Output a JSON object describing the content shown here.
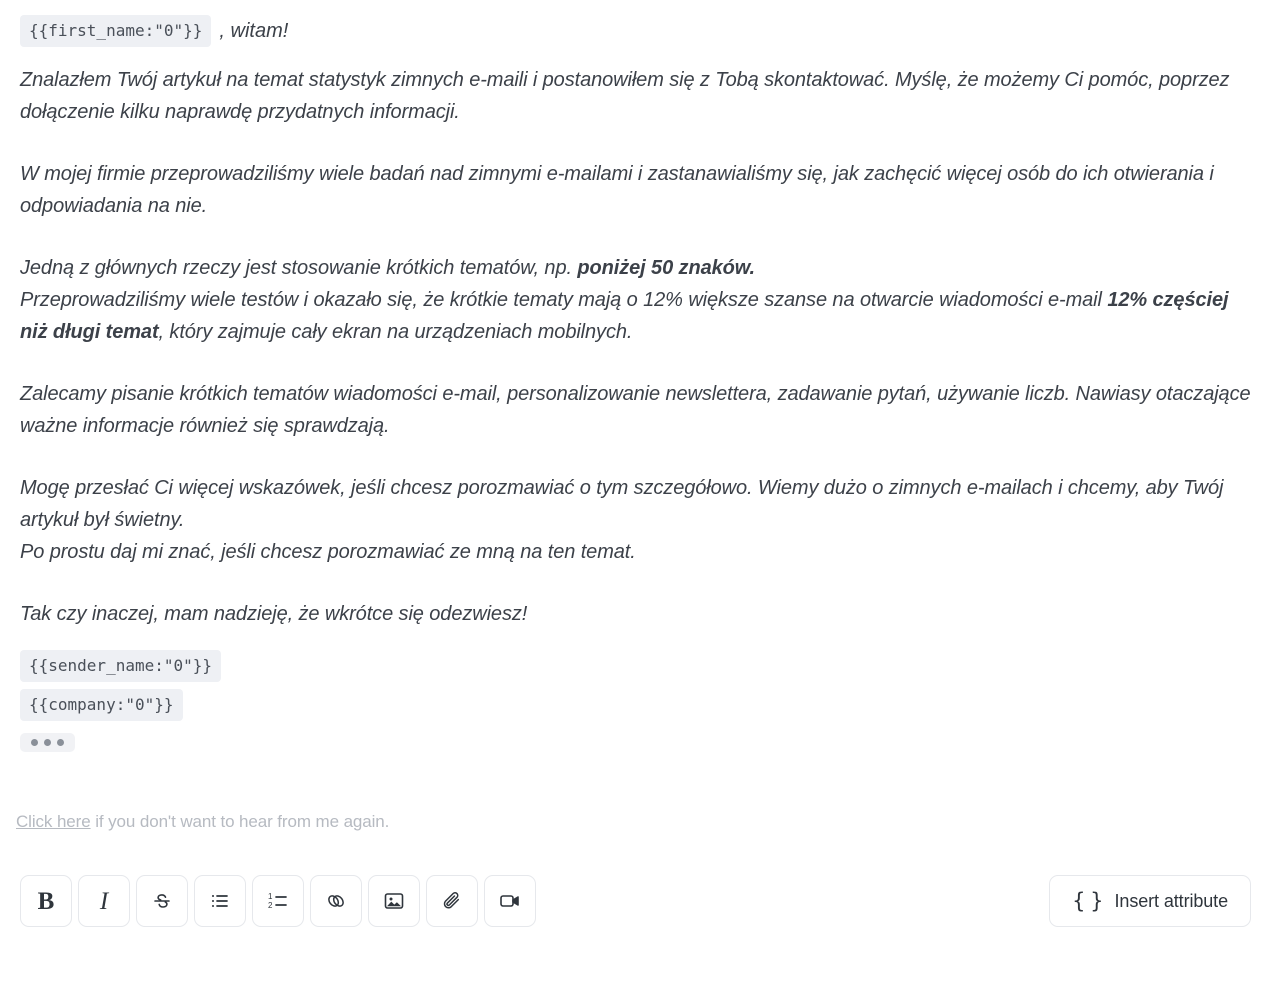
{
  "colors": {
    "text": "#3c4149",
    "chip_bg": "#eef0f4",
    "chip_text": "#4a5059",
    "muted": "#b6bac1",
    "border": "#e6e8ec",
    "surface": "#ffffff"
  },
  "message": {
    "greeting": {
      "token": "{{first_name:\"0\"}}",
      "suffix": ", witam!"
    },
    "paragraphs": [
      {
        "id": "intro",
        "runs": [
          {
            "text": "Znalazłem Twój artykuł na temat statystyk zimnych e-maili i postanowiłem się z Tobą skontaktować. Myślę, że możemy Ci pomóc, poprzez dołączenie kilku naprawdę przydatnych informacji.",
            "bold": false
          }
        ]
      },
      {
        "id": "research",
        "runs": [
          {
            "text": "W mojej firmie przeprowadziliśmy wiele badań nad zimnymi e-mailami i zastanawialiśmy się, jak zachęcić więcej osób do ich otwierania i odpowiadania na nie.",
            "bold": false
          }
        ]
      },
      {
        "id": "subject-length",
        "runs": [
          {
            "text": "Jedną z głównych rzeczy jest stosowanie krótkich tematów, np. ",
            "bold": false
          },
          {
            "text": "poniżej 50 znaków.",
            "bold": true
          },
          {
            "text": "\nPrzeprowadziliśmy wiele testów i okazało się, że krótkie tematy mają o 12% większe szanse na otwarcie wiadomości e-mail ",
            "bold": false
          },
          {
            "text": "12% częściej niż długi temat",
            "bold": true
          },
          {
            "text": ", który zajmuje cały ekran na urządzeniach mobilnych.",
            "bold": false
          }
        ]
      },
      {
        "id": "recommendations",
        "runs": [
          {
            "text": "Zalecamy pisanie krótkich tematów wiadomości e-mail, personalizowanie newslettera, zadawanie pytań, używanie liczb. Nawiasy otaczające ważne informacje również się sprawdzają.",
            "bold": false
          }
        ]
      },
      {
        "id": "offer",
        "runs": [
          {
            "text": "Mogę przesłać Ci więcej wskazówek, jeśli chcesz porozmawiać o tym szczegółowo. Wiemy dużo o zimnych e-mailach i chcemy, aby Twój artykuł był świetny.\nPo prostu daj mi znać, jeśli chcesz porozmawiać ze mną na ten temat.",
            "bold": false
          }
        ]
      },
      {
        "id": "closing",
        "runs": [
          {
            "text": "Tak czy inaczej, mam nadzieję, że wkrótce się odezwiesz!",
            "bold": false
          }
        ]
      }
    ],
    "signature": {
      "sender_token": "{{sender_name:\"0\"}}",
      "company_token": "{{company:\"0\"}}",
      "more_indicator": "•••"
    }
  },
  "unsubscribe": {
    "link_label": "Click here",
    "rest": " if you don't want to hear from me again."
  },
  "toolbar": {
    "buttons": [
      {
        "name": "bold",
        "label": "B",
        "icon": "bold-icon"
      },
      {
        "name": "italic",
        "label": "I",
        "icon": "italic-icon"
      },
      {
        "name": "strikethrough",
        "label": "S",
        "icon": "strikethrough-icon"
      },
      {
        "name": "bulleted-list",
        "label": "",
        "icon": "bulleted-list-icon"
      },
      {
        "name": "numbered-list",
        "label": "",
        "icon": "numbered-list-icon"
      },
      {
        "name": "link",
        "label": "",
        "icon": "link-icon"
      },
      {
        "name": "image",
        "label": "",
        "icon": "image-icon"
      },
      {
        "name": "attachment",
        "label": "",
        "icon": "paperclip-icon"
      },
      {
        "name": "video",
        "label": "",
        "icon": "video-camera-icon"
      }
    ],
    "insert_attribute": {
      "icon": "{ }",
      "label": "Insert attribute"
    }
  }
}
